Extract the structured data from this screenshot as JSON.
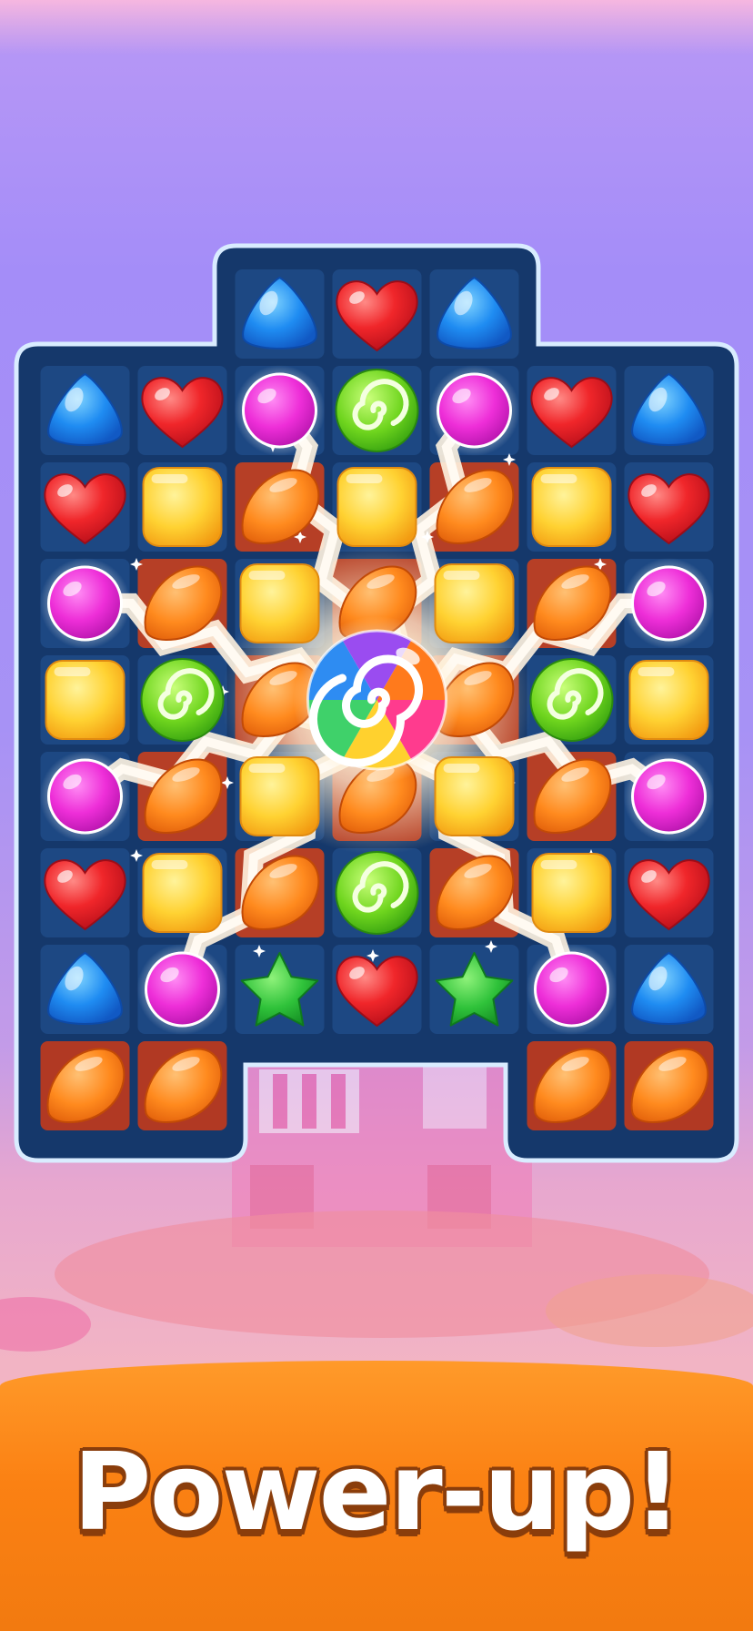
{
  "banner": {
    "text": "Power-up!"
  },
  "colors": {
    "board_fill": "#15386b",
    "board_border": "#d9ecff",
    "banner_orange": "#fb8113",
    "burst_white": "#fffaf2"
  },
  "board": {
    "rows": [
      [
        "none",
        "none",
        "blue-drop",
        "red-heart",
        "blue-drop",
        "none",
        "none"
      ],
      [
        "blue-drop",
        "red-heart",
        "magenta-ball",
        "green-swirl",
        "magenta-ball",
        "red-heart",
        "blue-drop"
      ],
      [
        "red-heart",
        "yellow-square",
        "orange-jelly",
        "yellow-square",
        "orange-jelly",
        "yellow-square",
        "red-heart"
      ],
      [
        "magenta-ball",
        "orange-jelly",
        "yellow-square",
        "orange-jelly",
        "yellow-square",
        "orange-jelly",
        "magenta-ball"
      ],
      [
        "yellow-square",
        "green-swirl",
        "orange-jelly",
        "color-bomb",
        "orange-jelly",
        "green-swirl",
        "yellow-square"
      ],
      [
        "magenta-ball",
        "orange-jelly",
        "yellow-square",
        "orange-jelly",
        "yellow-square",
        "orange-jelly",
        "magenta-ball"
      ],
      [
        "red-heart",
        "yellow-square",
        "orange-jelly",
        "green-swirl",
        "orange-jelly",
        "yellow-square",
        "red-heart"
      ],
      [
        "blue-drop",
        "magenta-ball",
        "green-star",
        "red-heart",
        "green-star",
        "magenta-ball",
        "blue-drop"
      ],
      [
        "orange-jelly",
        "orange-jelly",
        "none",
        "none",
        "none",
        "orange-jelly",
        "orange-jelly"
      ]
    ],
    "power_up": {
      "name": "rainbow-color-bomb",
      "row": 4,
      "col": 3
    }
  }
}
